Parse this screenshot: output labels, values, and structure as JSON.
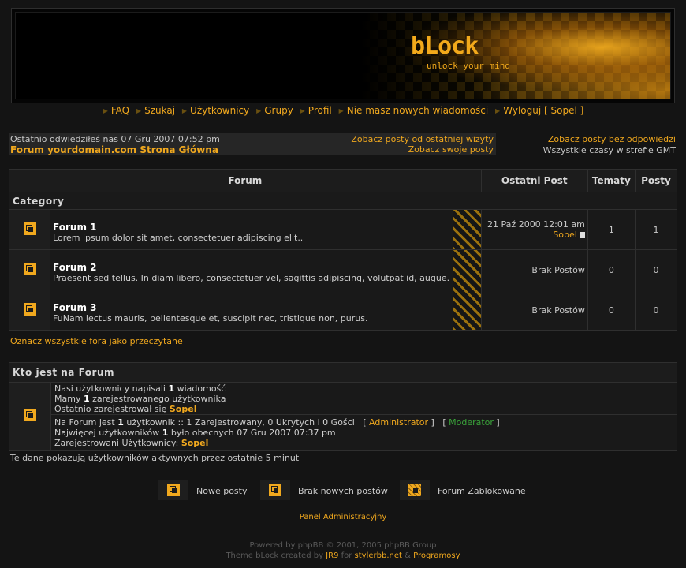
{
  "banner": {
    "title": "bLock",
    "subtitle": "unlock your mind"
  },
  "nav": [
    "FAQ",
    "Szukaj",
    "Użytkownicy",
    "Grupy",
    "Profil",
    "Nie masz nowych wiadomości",
    "Wyloguj [ Sopel ]"
  ],
  "info": {
    "last_visit": "Ostatnio odwiedziłeś nas 07 Gru 2007 07:52 pm",
    "index_link": "Forum yourdomain.com Strona Główna",
    "posts_since": "Zobacz posty od ostatniej wizyty",
    "your_posts": "Zobacz swoje posty",
    "unanswered": "Zobacz posty bez odpowiedzi",
    "timezone": "Wszystkie czasy w strefie GMT"
  },
  "table": {
    "headers": {
      "forum": "Forum",
      "last_post": "Ostatni Post",
      "topics": "Tematy",
      "posts": "Posty"
    },
    "category": "Category",
    "forums": [
      {
        "name": "Forum 1",
        "desc": "Lorem ipsum dolor sit amet, consectetuer adipiscing elit..",
        "last_date": "21 Paź 2000 12:01 am",
        "last_user": "Sopel",
        "topics": "1",
        "posts": "1"
      },
      {
        "name": "Forum 2",
        "desc": "Praesent sed tellus. In diam libero, consectetuer vel, sagittis adipiscing, volutpat id, augue.",
        "last_date": "Brak Postów",
        "last_user": "",
        "topics": "0",
        "posts": "0"
      },
      {
        "name": "Forum 3",
        "desc": "FuNam lectus mauris, pellentesque et, suscipit nec, tristique non, purus.",
        "last_date": "Brak Postów",
        "last_user": "",
        "topics": "0",
        "posts": "0"
      }
    ]
  },
  "mark_read": "Oznacz wszystkie fora jako przeczytane",
  "who": {
    "title": "Kto jest na Forum",
    "l1_a": "Nasi użytkownicy napisali ",
    "l1_b": "1",
    "l1_c": " wiadomość",
    "l2_a": "Mamy ",
    "l2_b": "1",
    "l2_c": " zarejestrowanego użytkownika",
    "l3_a": "Ostatnio zarejestrował się ",
    "l3_b": "Sopel",
    "l4_a": "Na Forum jest ",
    "l4_b": "1",
    "l4_c": " użytkownik :: 1 Zarejestrowany, 0 Ukrytych i 0 Gości   [ ",
    "l4_admin": "Administrator",
    "l4_d": " ]   [ ",
    "l4_mod": "Moderator",
    "l4_e": " ]",
    "l5_a": "Najwięcej użytkowników ",
    "l5_b": "1",
    "l5_c": " było obecnych 07 Gru 2007 07:37 pm",
    "l6_a": "Zarejestrowani Użytkownicy: ",
    "l6_b": "Sopel"
  },
  "active_note": "Te dane pokazują użytkowników aktywnych przez ostatnie 5 minut",
  "legend": {
    "new": "Nowe posty",
    "none": "Brak nowych postów",
    "locked": "Forum Zablokowane"
  },
  "admin_panel": "Panel Administracyjny",
  "footer": {
    "powered": "Powered by phpBB © 2001, 2005 phpBB Group",
    "theme_a": "Theme bLock created by ",
    "jr9": "JR9",
    "for": " for ",
    "stylerbb": "stylerbb.net",
    "amp": " & ",
    "programosy": "Programosy"
  },
  "colors": {
    "accent": "#f0a81e",
    "background": "#141414",
    "panel": "#191919",
    "moderator": "#3aa43a"
  }
}
